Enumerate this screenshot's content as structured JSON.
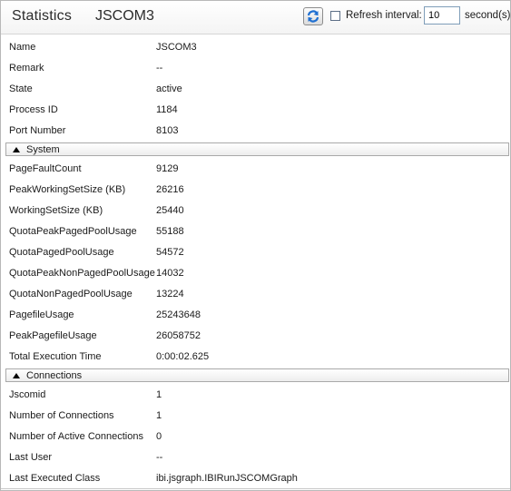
{
  "header": {
    "title": "Statistics",
    "subtitle": "JSCOM3",
    "refresh_label": "Refresh interval:",
    "interval_value": "10",
    "seconds_label": "second(s)",
    "refresh_checked": false
  },
  "general": [
    {
      "key": "Name",
      "value": "JSCOM3"
    },
    {
      "key": "Remark",
      "value": "--"
    },
    {
      "key": "State",
      "value": "active"
    },
    {
      "key": "Process ID",
      "value": "1184"
    },
    {
      "key": "Port Number",
      "value": "8103"
    }
  ],
  "system": {
    "label": "System",
    "rows": [
      {
        "key": "PageFaultCount",
        "value": "9129"
      },
      {
        "key": "PeakWorkingSetSize (KB)",
        "value": "26216"
      },
      {
        "key": "WorkingSetSize (KB)",
        "value": "25440"
      },
      {
        "key": "QuotaPeakPagedPoolUsage",
        "value": "55188"
      },
      {
        "key": "QuotaPagedPoolUsage",
        "value": "54572"
      },
      {
        "key": "QuotaPeakNonPagedPoolUsage",
        "value": "14032"
      },
      {
        "key": "QuotaNonPagedPoolUsage",
        "value": "13224"
      },
      {
        "key": "PagefileUsage",
        "value": "25243648"
      },
      {
        "key": "PeakPagefileUsage",
        "value": "26058752"
      },
      {
        "key": "Total Execution Time",
        "value": "0:00:02.625"
      }
    ]
  },
  "connections": {
    "label": "Connections",
    "rows": [
      {
        "key": "Jscomid",
        "value": "1"
      },
      {
        "key": "Number of Connections",
        "value": "1"
      },
      {
        "key": "Number of Active Connections",
        "value": "0"
      },
      {
        "key": "Last User",
        "value": "--"
      },
      {
        "key": "Last Executed Class",
        "value": "ibi.jsgraph.IBIRunJSCOMGraph"
      }
    ]
  },
  "icons": {
    "refresh": "refresh-icon",
    "collapse": "collapse-triangle-icon"
  }
}
